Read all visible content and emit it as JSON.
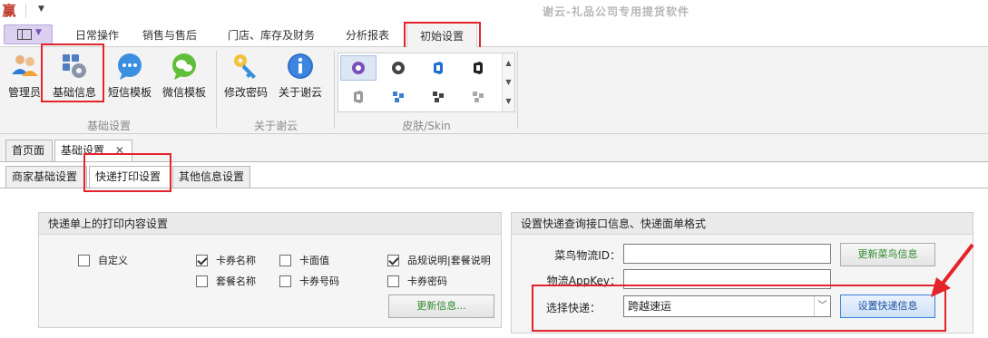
{
  "title_bar": {
    "app_logo": "赢",
    "quick_access_arrow": "▼",
    "window_title": "谢云-礼品公司专用提货软件"
  },
  "ribbon_tabs": [
    {
      "label": "日常操作",
      "active": false
    },
    {
      "label": "销售与售后",
      "active": false
    },
    {
      "label": "门店、库存及财务",
      "active": false
    },
    {
      "label": "分析报表",
      "active": false
    },
    {
      "label": "初始设置",
      "active": true
    }
  ],
  "ribbon": {
    "groups": {
      "basic": {
        "label": "基础设置",
        "buttons": [
          {
            "label": "管理员",
            "icon": "users-icon"
          },
          {
            "label": "基础信息",
            "icon": "settings-icon"
          },
          {
            "label": "短信模板",
            "icon": "sms-icon"
          },
          {
            "label": "微信模板",
            "icon": "wechat-icon"
          }
        ]
      },
      "about": {
        "label": "关于谢云",
        "buttons": [
          {
            "label": "修改密码",
            "icon": "key-icon"
          },
          {
            "label": "关于谢云",
            "icon": "info-icon"
          }
        ]
      },
      "skin": {
        "label": "皮肤/Skin"
      }
    }
  },
  "doc_tabs": [
    {
      "label": "首页面",
      "active": false
    },
    {
      "label": "基础设置",
      "active": true,
      "close": "✕"
    }
  ],
  "sub_tabs": [
    {
      "label": "商家基础设置",
      "active": false
    },
    {
      "label": "快递打印设置",
      "active": true
    },
    {
      "label": "其他信息设置",
      "active": false
    }
  ],
  "print_panel": {
    "title": "快递单上的打印内容设置",
    "checkboxes": [
      {
        "label": "自定义",
        "checked": false
      },
      {
        "label": "卡券名称",
        "checked": true
      },
      {
        "label": "卡面值",
        "checked": false
      },
      {
        "label": "品规说明|套餐说明",
        "checked": true
      },
      {
        "label": "套餐名称",
        "checked": false
      },
      {
        "label": "卡券号码",
        "checked": false
      },
      {
        "label": "卡券密码",
        "checked": false
      }
    ],
    "update_button": "更新信息..."
  },
  "express_panel": {
    "title": "设置快递查询接口信息、快递面单格式",
    "cainiao_label": "菜鸟物流ID：",
    "cainiao_value": "",
    "appkey_label": "物流AppKey：",
    "appkey_value": "",
    "select_label": "选择快递：",
    "selected_express": "跨越速运",
    "update_cainiao_button": "更新菜鸟信息",
    "set_express_button": "设置快递信息"
  },
  "colors": {
    "highlight_red": "#e4232c",
    "green_text": "#2e8b2e",
    "blue_text": "#1e4f9a"
  }
}
